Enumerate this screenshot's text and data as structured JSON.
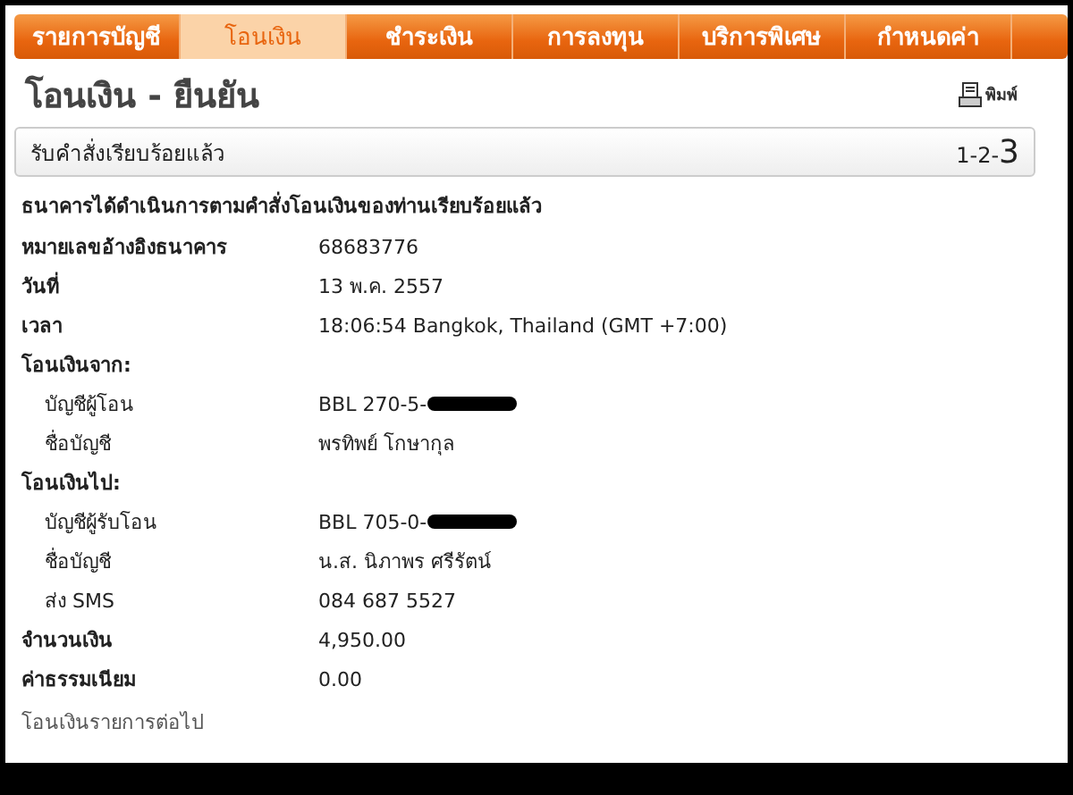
{
  "tabs": [
    {
      "label": "รายการบัญชี",
      "selected": false
    },
    {
      "label": "โอนเงิน",
      "selected": true
    },
    {
      "label": "ชำระเงิน",
      "selected": false
    },
    {
      "label": "การลงทุน",
      "selected": false
    },
    {
      "label": "บริการพิเศษ",
      "selected": false
    },
    {
      "label": "กำหนดค่า",
      "selected": false
    }
  ],
  "page_title": "โอนเงิน - ยืนยัน",
  "print_link": "พิมพ์",
  "status_bar": {
    "text": "รับคำสั่งเรียบร้อยแล้ว",
    "step_separator": "-",
    "steps": [
      {
        "label": "1",
        "selected": false
      },
      {
        "label": "2",
        "selected": false
      },
      {
        "label": "3",
        "selected": true
      }
    ]
  },
  "message": "ธนาคารได้ดำเนินการตามคำสั่งโอนเงินของท่านเรียบร้อยแล้ว",
  "rows": [
    {
      "kind": "field",
      "label": "หมายเลขอ้างอิงธนาคาร",
      "value": "68683776"
    },
    {
      "kind": "field",
      "label": "วันที่",
      "value": "13 พ.ค. 2557"
    },
    {
      "kind": "field",
      "label": "เวลา",
      "value": "18:06:54 Bangkok, Thailand (GMT +7:00)"
    },
    {
      "kind": "section",
      "label": "โอนเงินจาก:"
    },
    {
      "kind": "subfield",
      "label": "บัญชีผู้โอน",
      "value": "BBL 270-5-",
      "redacted": true
    },
    {
      "kind": "subfield",
      "label": "ชื่อบัญชี",
      "value": "พรทิพย์ โกษากุล"
    },
    {
      "kind": "section",
      "label": "โอนเงินไป:"
    },
    {
      "kind": "subfield",
      "label": "บัญชีผู้รับโอน",
      "value": "BBL 705-0-",
      "redacted": true
    },
    {
      "kind": "subfield",
      "label": "ชื่อบัญชี",
      "value": "น.ส. นิภาพร ศรีรัตน์"
    },
    {
      "kind": "subfield",
      "label": "ส่ง SMS",
      "value": "084 687 5527"
    },
    {
      "kind": "field",
      "label": "จำนวนเงิน",
      "value": "4,950.00"
    },
    {
      "kind": "field",
      "label": "ค่าธรรมเนียม",
      "value": "0.00"
    }
  ],
  "next_link": "โอนเงินรายการต่อไป"
}
